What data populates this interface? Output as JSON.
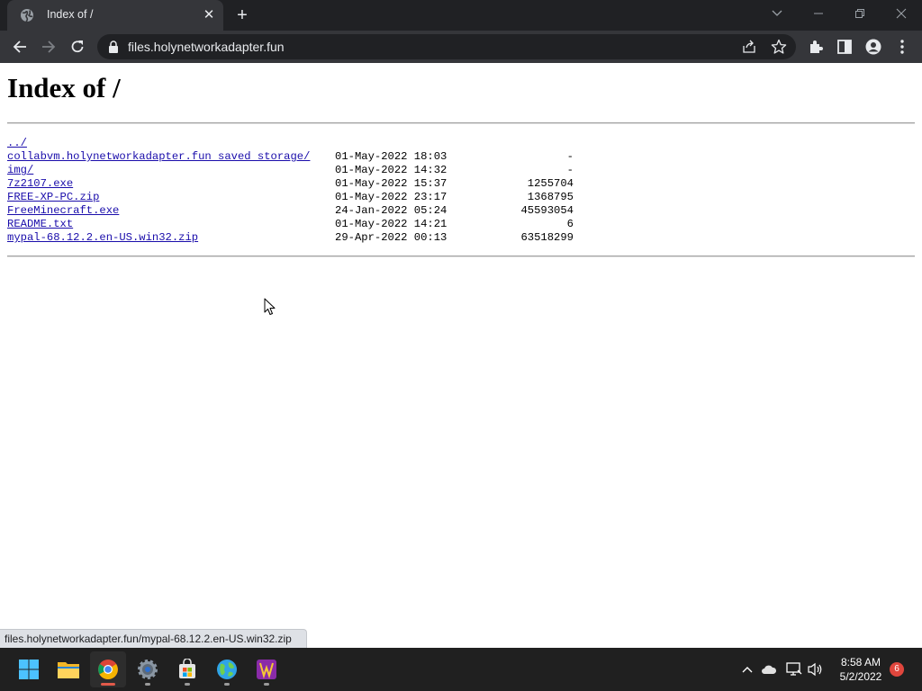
{
  "browser": {
    "tab_title": "Index of /",
    "url": "files.holynetworkadapter.fun",
    "status_url": "files.holynetworkadapter.fun/mypal-68.12.2.en-US.win32.zip"
  },
  "page": {
    "heading": "Index of /",
    "entries": [
      {
        "name": "../",
        "date": "",
        "size": ""
      },
      {
        "name": "collabvm.holynetworkadapter.fun saved storage/",
        "date": "01-May-2022 18:03",
        "size": "-"
      },
      {
        "name": "img/",
        "date": "01-May-2022 14:32",
        "size": "-"
      },
      {
        "name": "7z2107.exe",
        "date": "01-May-2022 15:37",
        "size": "1255704"
      },
      {
        "name": "FREE-XP-PC.zip",
        "date": "01-May-2022 23:17",
        "size": "1368795"
      },
      {
        "name": "FreeMinecraft.exe",
        "date": "24-Jan-2022 05:24",
        "size": "45593054"
      },
      {
        "name": "README.txt",
        "date": "01-May-2022 14:21",
        "size": "6"
      },
      {
        "name": "mypal-68.12.2.en-US.win32.zip",
        "date": "29-Apr-2022 00:13",
        "size": "63518299"
      }
    ]
  },
  "taskbar": {
    "time": "8:58 AM",
    "date": "5/2/2022",
    "notification_count": "6",
    "apps": [
      "start-icon",
      "file-explorer-icon",
      "chrome-icon",
      "settings-icon",
      "store-icon",
      "globe-icon",
      "winamp-icon"
    ]
  },
  "colors": {
    "link": "#1a0dab",
    "tab_strip": "#202124",
    "toolbar": "#35363a",
    "taskbar": "#202020",
    "chrome_indicator": "#e25a4a"
  }
}
